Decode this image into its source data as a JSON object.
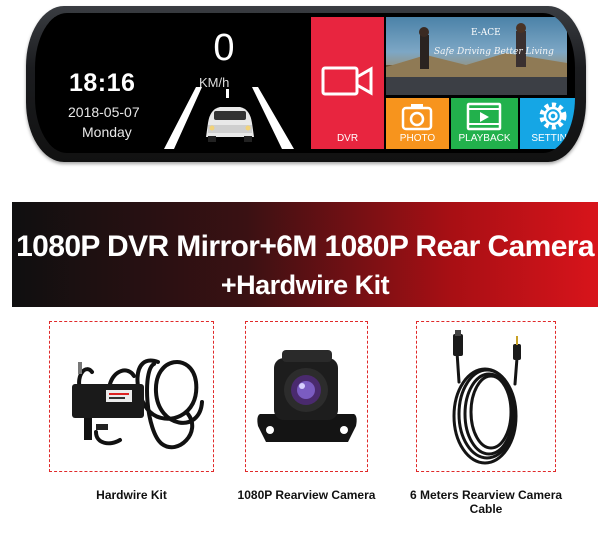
{
  "dashboard": {
    "time": "18:16",
    "date": "2018-05-07",
    "weekday": "Monday",
    "speed": "0",
    "speed_unit": "KM/h"
  },
  "tiles": {
    "dvr": "DVR",
    "photo": "PHOTO",
    "playback": "PLAYBACK",
    "setting": "SETTING"
  },
  "video": {
    "brand": "E-ACE",
    "slogan": "Safe Driving Better Living"
  },
  "banner": {
    "line1": "1080P DVR Mirror+6M 1080P Rear Camera",
    "line2": "+Hardwire Kit"
  },
  "products": {
    "kit": "Hardwire Kit",
    "camera": "1080P Rearview Camera",
    "cable": "6 Meters Rearview Camera Cable"
  },
  "colors": {
    "dvr": "#e8253f",
    "photo": "#f7941d",
    "playback": "#22b14c",
    "setting": "#15a6e5",
    "dash_border": "#e02a2a"
  }
}
